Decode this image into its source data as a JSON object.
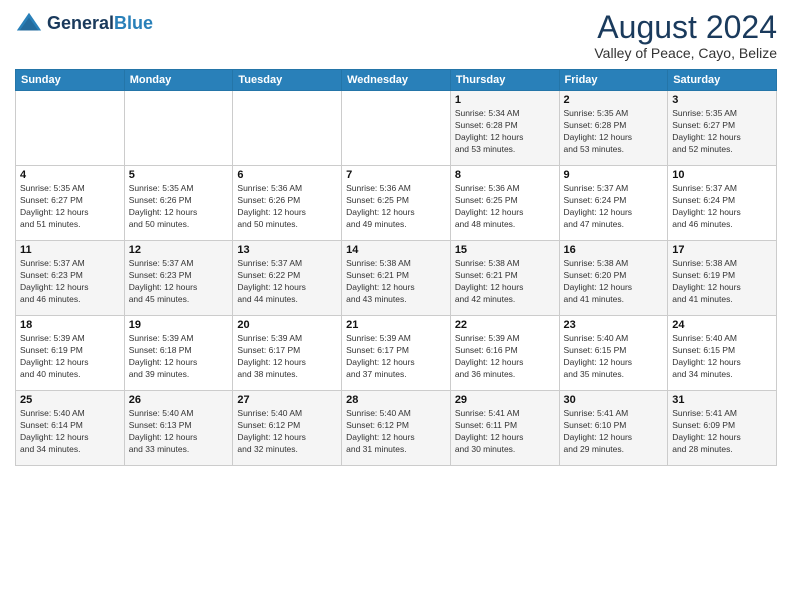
{
  "logo": {
    "line1": "General",
    "line2": "Blue"
  },
  "header": {
    "month": "August 2024",
    "location": "Valley of Peace, Cayo, Belize"
  },
  "days_of_week": [
    "Sunday",
    "Monday",
    "Tuesday",
    "Wednesday",
    "Thursday",
    "Friday",
    "Saturday"
  ],
  "weeks": [
    [
      {
        "day": "",
        "content": ""
      },
      {
        "day": "",
        "content": ""
      },
      {
        "day": "",
        "content": ""
      },
      {
        "day": "",
        "content": ""
      },
      {
        "day": "1",
        "content": "Sunrise: 5:34 AM\nSunset: 6:28 PM\nDaylight: 12 hours\nand 53 minutes."
      },
      {
        "day": "2",
        "content": "Sunrise: 5:35 AM\nSunset: 6:28 PM\nDaylight: 12 hours\nand 53 minutes."
      },
      {
        "day": "3",
        "content": "Sunrise: 5:35 AM\nSunset: 6:27 PM\nDaylight: 12 hours\nand 52 minutes."
      }
    ],
    [
      {
        "day": "4",
        "content": "Sunrise: 5:35 AM\nSunset: 6:27 PM\nDaylight: 12 hours\nand 51 minutes."
      },
      {
        "day": "5",
        "content": "Sunrise: 5:35 AM\nSunset: 6:26 PM\nDaylight: 12 hours\nand 50 minutes."
      },
      {
        "day": "6",
        "content": "Sunrise: 5:36 AM\nSunset: 6:26 PM\nDaylight: 12 hours\nand 50 minutes."
      },
      {
        "day": "7",
        "content": "Sunrise: 5:36 AM\nSunset: 6:25 PM\nDaylight: 12 hours\nand 49 minutes."
      },
      {
        "day": "8",
        "content": "Sunrise: 5:36 AM\nSunset: 6:25 PM\nDaylight: 12 hours\nand 48 minutes."
      },
      {
        "day": "9",
        "content": "Sunrise: 5:37 AM\nSunset: 6:24 PM\nDaylight: 12 hours\nand 47 minutes."
      },
      {
        "day": "10",
        "content": "Sunrise: 5:37 AM\nSunset: 6:24 PM\nDaylight: 12 hours\nand 46 minutes."
      }
    ],
    [
      {
        "day": "11",
        "content": "Sunrise: 5:37 AM\nSunset: 6:23 PM\nDaylight: 12 hours\nand 46 minutes."
      },
      {
        "day": "12",
        "content": "Sunrise: 5:37 AM\nSunset: 6:23 PM\nDaylight: 12 hours\nand 45 minutes."
      },
      {
        "day": "13",
        "content": "Sunrise: 5:37 AM\nSunset: 6:22 PM\nDaylight: 12 hours\nand 44 minutes."
      },
      {
        "day": "14",
        "content": "Sunrise: 5:38 AM\nSunset: 6:21 PM\nDaylight: 12 hours\nand 43 minutes."
      },
      {
        "day": "15",
        "content": "Sunrise: 5:38 AM\nSunset: 6:21 PM\nDaylight: 12 hours\nand 42 minutes."
      },
      {
        "day": "16",
        "content": "Sunrise: 5:38 AM\nSunset: 6:20 PM\nDaylight: 12 hours\nand 41 minutes."
      },
      {
        "day": "17",
        "content": "Sunrise: 5:38 AM\nSunset: 6:19 PM\nDaylight: 12 hours\nand 41 minutes."
      }
    ],
    [
      {
        "day": "18",
        "content": "Sunrise: 5:39 AM\nSunset: 6:19 PM\nDaylight: 12 hours\nand 40 minutes."
      },
      {
        "day": "19",
        "content": "Sunrise: 5:39 AM\nSunset: 6:18 PM\nDaylight: 12 hours\nand 39 minutes."
      },
      {
        "day": "20",
        "content": "Sunrise: 5:39 AM\nSunset: 6:17 PM\nDaylight: 12 hours\nand 38 minutes."
      },
      {
        "day": "21",
        "content": "Sunrise: 5:39 AM\nSunset: 6:17 PM\nDaylight: 12 hours\nand 37 minutes."
      },
      {
        "day": "22",
        "content": "Sunrise: 5:39 AM\nSunset: 6:16 PM\nDaylight: 12 hours\nand 36 minutes."
      },
      {
        "day": "23",
        "content": "Sunrise: 5:40 AM\nSunset: 6:15 PM\nDaylight: 12 hours\nand 35 minutes."
      },
      {
        "day": "24",
        "content": "Sunrise: 5:40 AM\nSunset: 6:15 PM\nDaylight: 12 hours\nand 34 minutes."
      }
    ],
    [
      {
        "day": "25",
        "content": "Sunrise: 5:40 AM\nSunset: 6:14 PM\nDaylight: 12 hours\nand 34 minutes."
      },
      {
        "day": "26",
        "content": "Sunrise: 5:40 AM\nSunset: 6:13 PM\nDaylight: 12 hours\nand 33 minutes."
      },
      {
        "day": "27",
        "content": "Sunrise: 5:40 AM\nSunset: 6:12 PM\nDaylight: 12 hours\nand 32 minutes."
      },
      {
        "day": "28",
        "content": "Sunrise: 5:40 AM\nSunset: 6:12 PM\nDaylight: 12 hours\nand 31 minutes."
      },
      {
        "day": "29",
        "content": "Sunrise: 5:41 AM\nSunset: 6:11 PM\nDaylight: 12 hours\nand 30 minutes."
      },
      {
        "day": "30",
        "content": "Sunrise: 5:41 AM\nSunset: 6:10 PM\nDaylight: 12 hours\nand 29 minutes."
      },
      {
        "day": "31",
        "content": "Sunrise: 5:41 AM\nSunset: 6:09 PM\nDaylight: 12 hours\nand 28 minutes."
      }
    ]
  ]
}
